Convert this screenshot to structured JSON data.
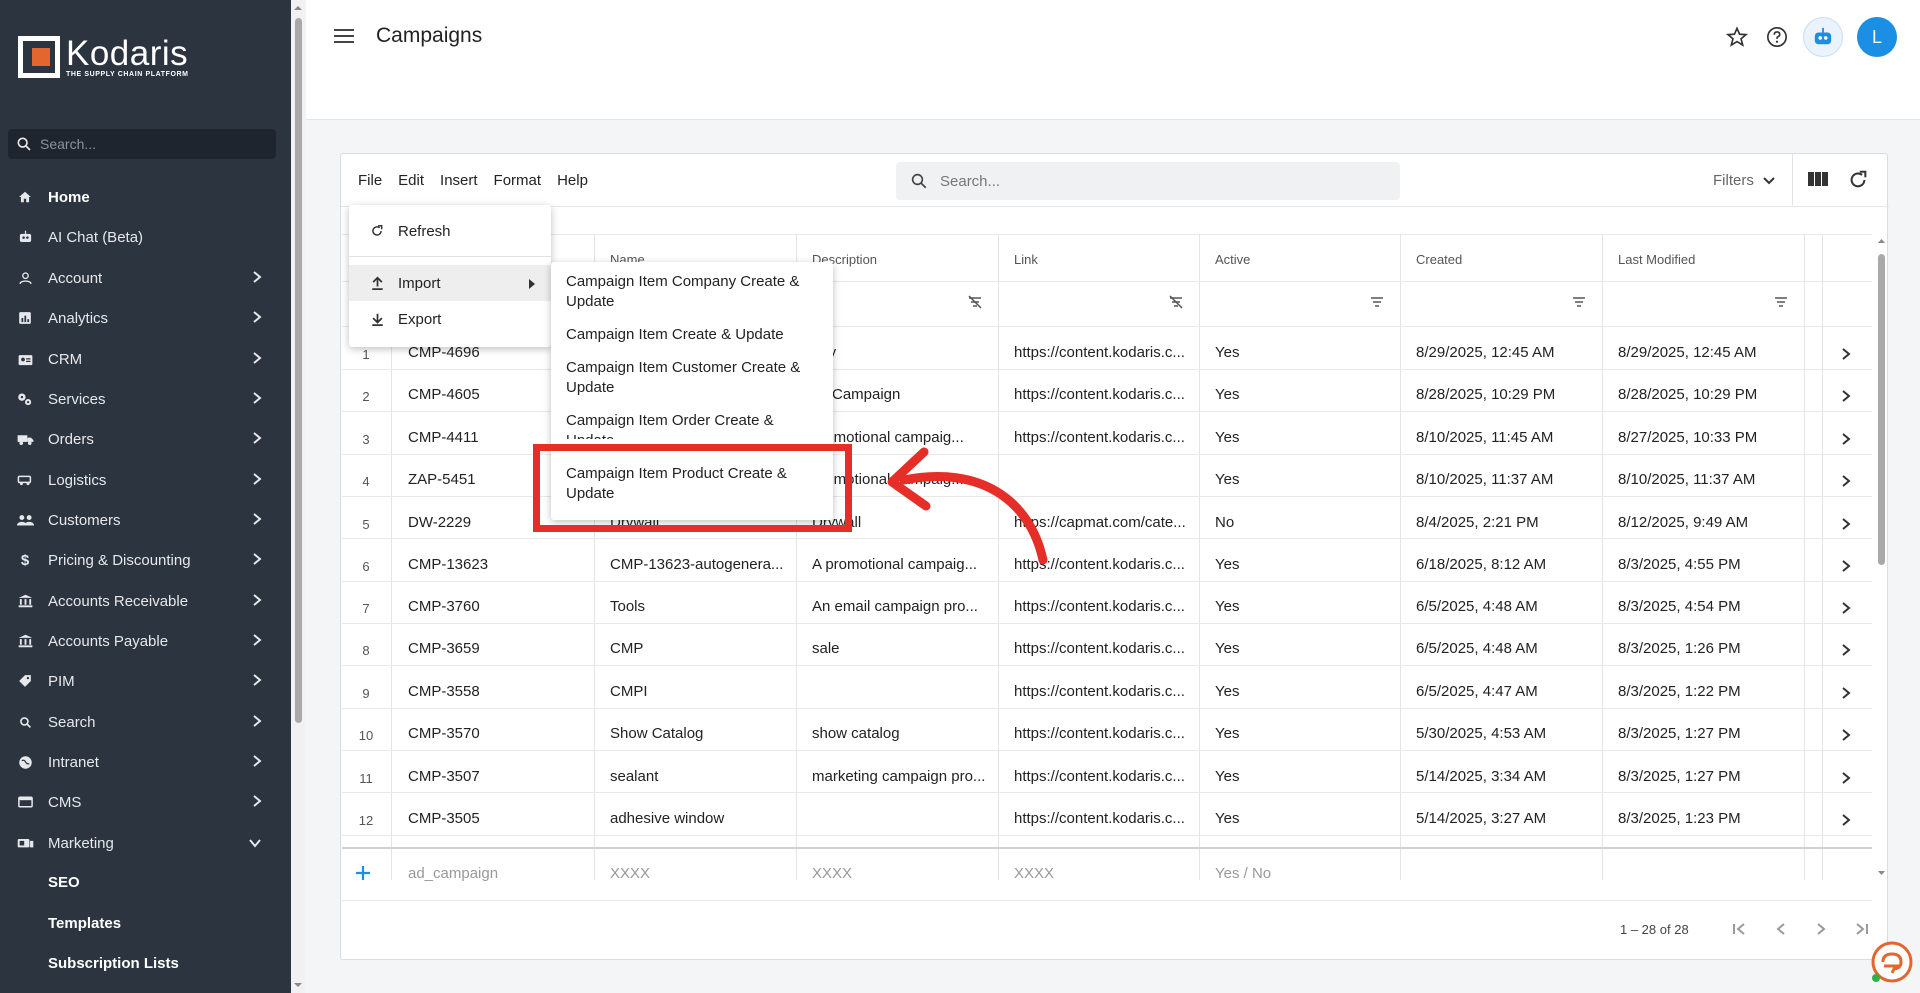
{
  "sidebar": {
    "logo_name": "Kodaris",
    "logo_tag": "THE SUPPLY CHAIN PLATFORM",
    "search_placeholder": "Search...",
    "items": [
      {
        "label": "Home",
        "icon": "home-icon"
      },
      {
        "label": "AI Chat (Beta)",
        "icon": "robot-icon"
      },
      {
        "label": "Account",
        "icon": "person-icon"
      },
      {
        "label": "Analytics",
        "icon": "chart-icon"
      },
      {
        "label": "CRM",
        "icon": "contact-card-icon"
      },
      {
        "label": "Services",
        "icon": "cogs-icon"
      },
      {
        "label": "Orders",
        "icon": "truck-icon"
      },
      {
        "label": "Logistics",
        "icon": "van-icon"
      },
      {
        "label": "Customers",
        "icon": "people-icon"
      },
      {
        "label": "Pricing & Discounting",
        "icon": "dollar-icon"
      },
      {
        "label": "Accounts Receivable",
        "icon": "bank-icon"
      },
      {
        "label": "Accounts Payable",
        "icon": "bank-icon"
      },
      {
        "label": "PIM",
        "icon": "tag-icon"
      },
      {
        "label": "Search",
        "icon": "search-icon"
      },
      {
        "label": "Intranet",
        "icon": "globe-icon"
      },
      {
        "label": "CMS",
        "icon": "cms-icon"
      },
      {
        "label": "Marketing",
        "icon": "megaphone-icon"
      }
    ],
    "sub_items": [
      "SEO",
      "Templates",
      "Subscription Lists"
    ]
  },
  "header": {
    "title": "Campaigns",
    "avatar_letter": "L"
  },
  "toolbar": {
    "menu": [
      "File",
      "Edit",
      "Insert",
      "Format",
      "Help"
    ],
    "search_placeholder": "Search...",
    "filters_label": "Filters"
  },
  "file_menu": {
    "refresh": "Refresh",
    "import": "Import",
    "export": "Export"
  },
  "import_submenu": [
    "Campaign Item Company Create & Update",
    "Campaign Item Create & Update",
    "Campaign Item Customer Create & Update",
    "Campaign Item Order Create & Update",
    "Campaign Item Product Create & Update"
  ],
  "table": {
    "columns": [
      "Name",
      "Description",
      "Link",
      "Active",
      "Created",
      "Last Modified"
    ],
    "rows": [
      {
        "num": "1",
        "code": "CMP-4696",
        "name": "",
        "desc": "day",
        "link": "https://content.kodaris.c...",
        "active": "Yes",
        "created": "8/29/2025, 12:45 AM",
        "modified": "8/29/2025, 12:45 AM"
      },
      {
        "num": "2",
        "code": "CMP-4605",
        "name": "",
        "desc": "Campaign",
        "link": "https://content.kodaris.c...",
        "active": "Yes",
        "created": "8/28/2025, 10:29 PM",
        "modified": "8/28/2025, 10:29 PM"
      },
      {
        "num": "3",
        "code": "CMP-4411",
        "name": "",
        "desc": "promotional campaig...",
        "link": "https://content.kodaris.c...",
        "active": "Yes",
        "created": "8/10/2025, 11:45 AM",
        "modified": "8/27/2025, 10:33 PM"
      },
      {
        "num": "4",
        "code": "ZAP-5451",
        "name": "",
        "desc": "promotional campaig...",
        "link": "",
        "active": "Yes",
        "created": "8/10/2025, 11:37 AM",
        "modified": "8/10/2025, 11:37 AM"
      },
      {
        "num": "5",
        "code": "DW-2229",
        "name": "Drywall",
        "desc": "Drywall",
        "link": "https://capmat.com/cate...",
        "active": "No",
        "created": "8/4/2025, 2:21 PM",
        "modified": "8/12/2025, 9:49 AM"
      },
      {
        "num": "6",
        "code": "CMP-13623",
        "name": "CMP-13623-autogenera...",
        "desc": "A promotional campaig...",
        "link": "https://content.kodaris.c...",
        "active": "Yes",
        "created": "6/18/2025, 8:12 AM",
        "modified": "8/3/2025, 4:55 PM"
      },
      {
        "num": "7",
        "code": "CMP-3760",
        "name": "Tools",
        "desc": "An email campaign pro...",
        "link": "https://content.kodaris.c...",
        "active": "Yes",
        "created": "6/5/2025, 4:48 AM",
        "modified": "8/3/2025, 4:54 PM"
      },
      {
        "num": "8",
        "code": "CMP-3659",
        "name": "CMP",
        "desc": "sale",
        "link": "https://content.kodaris.c...",
        "active": "Yes",
        "created": "6/5/2025, 4:48 AM",
        "modified": "8/3/2025, 1:26 PM"
      },
      {
        "num": "9",
        "code": "CMP-3558",
        "name": "CMPI",
        "desc": "",
        "link": "https://content.kodaris.c...",
        "active": "Yes",
        "created": "6/5/2025, 4:47 AM",
        "modified": "8/3/2025, 1:22 PM"
      },
      {
        "num": "10",
        "code": "CMP-3570",
        "name": "Show Catalog",
        "desc": "show catalog",
        "link": "https://content.kodaris.c...",
        "active": "Yes",
        "created": "5/30/2025, 4:53 AM",
        "modified": "8/3/2025, 1:27 PM"
      },
      {
        "num": "11",
        "code": "CMP-3507",
        "name": "sealant",
        "desc": "marketing campaign pro...",
        "link": "https://content.kodaris.c...",
        "active": "Yes",
        "created": "5/14/2025, 3:34 AM",
        "modified": "8/3/2025, 1:27 PM"
      },
      {
        "num": "12",
        "code": "CMP-3505",
        "name": "adhesive window",
        "desc": "",
        "link": "https://content.kodaris.c...",
        "active": "Yes",
        "created": "5/14/2025, 3:27 AM",
        "modified": "8/3/2025, 1:23 PM"
      }
    ],
    "add_row": {
      "code": "ad_campaign",
      "name": "XXXX",
      "desc": "XXXX",
      "link": "XXXX",
      "active": "Yes / No"
    },
    "pager_text": "1 – 28 of 28"
  },
  "colors": {
    "sidebar_bg": "#2c3440",
    "accent": "#1a8fe3",
    "highlight_red": "#e52e27",
    "logo_orange": "#e2662d"
  }
}
